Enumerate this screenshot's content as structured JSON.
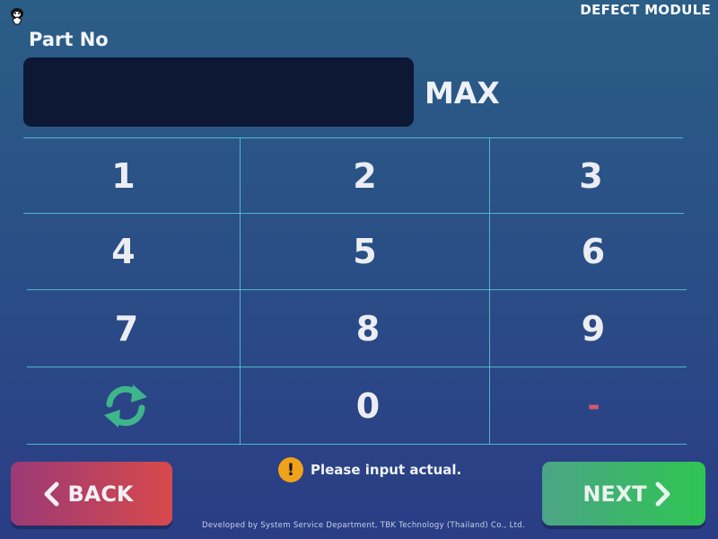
{
  "header": {
    "module_title": "DEFECT MODULE",
    "logo_icon": "penguin-logo-icon"
  },
  "form": {
    "field_label": "Part No",
    "input_value": "",
    "max_label": "MAX"
  },
  "keypad": {
    "keys": [
      "1",
      "2",
      "3",
      "4",
      "5",
      "6",
      "7",
      "8",
      "9",
      "",
      "0",
      "-"
    ],
    "reset_icon": "refresh-icon",
    "reset_color": "#3fb58b",
    "minus_color": "#d2596b",
    "line_color": "#59c8d6"
  },
  "nav": {
    "back_label": "BACK",
    "next_label": "NEXT",
    "back_gradient": [
      "#9a3a76",
      "#d8494b"
    ],
    "next_gradient": [
      "#4ca486",
      "#2ec552"
    ]
  },
  "status": {
    "message": "Please input actual.",
    "icon": "warning-icon",
    "icon_color": "#f0a21a"
  },
  "footer": {
    "text": "Developed by System Service Department, TBK Technology (Thailand) Co., Ltd."
  }
}
